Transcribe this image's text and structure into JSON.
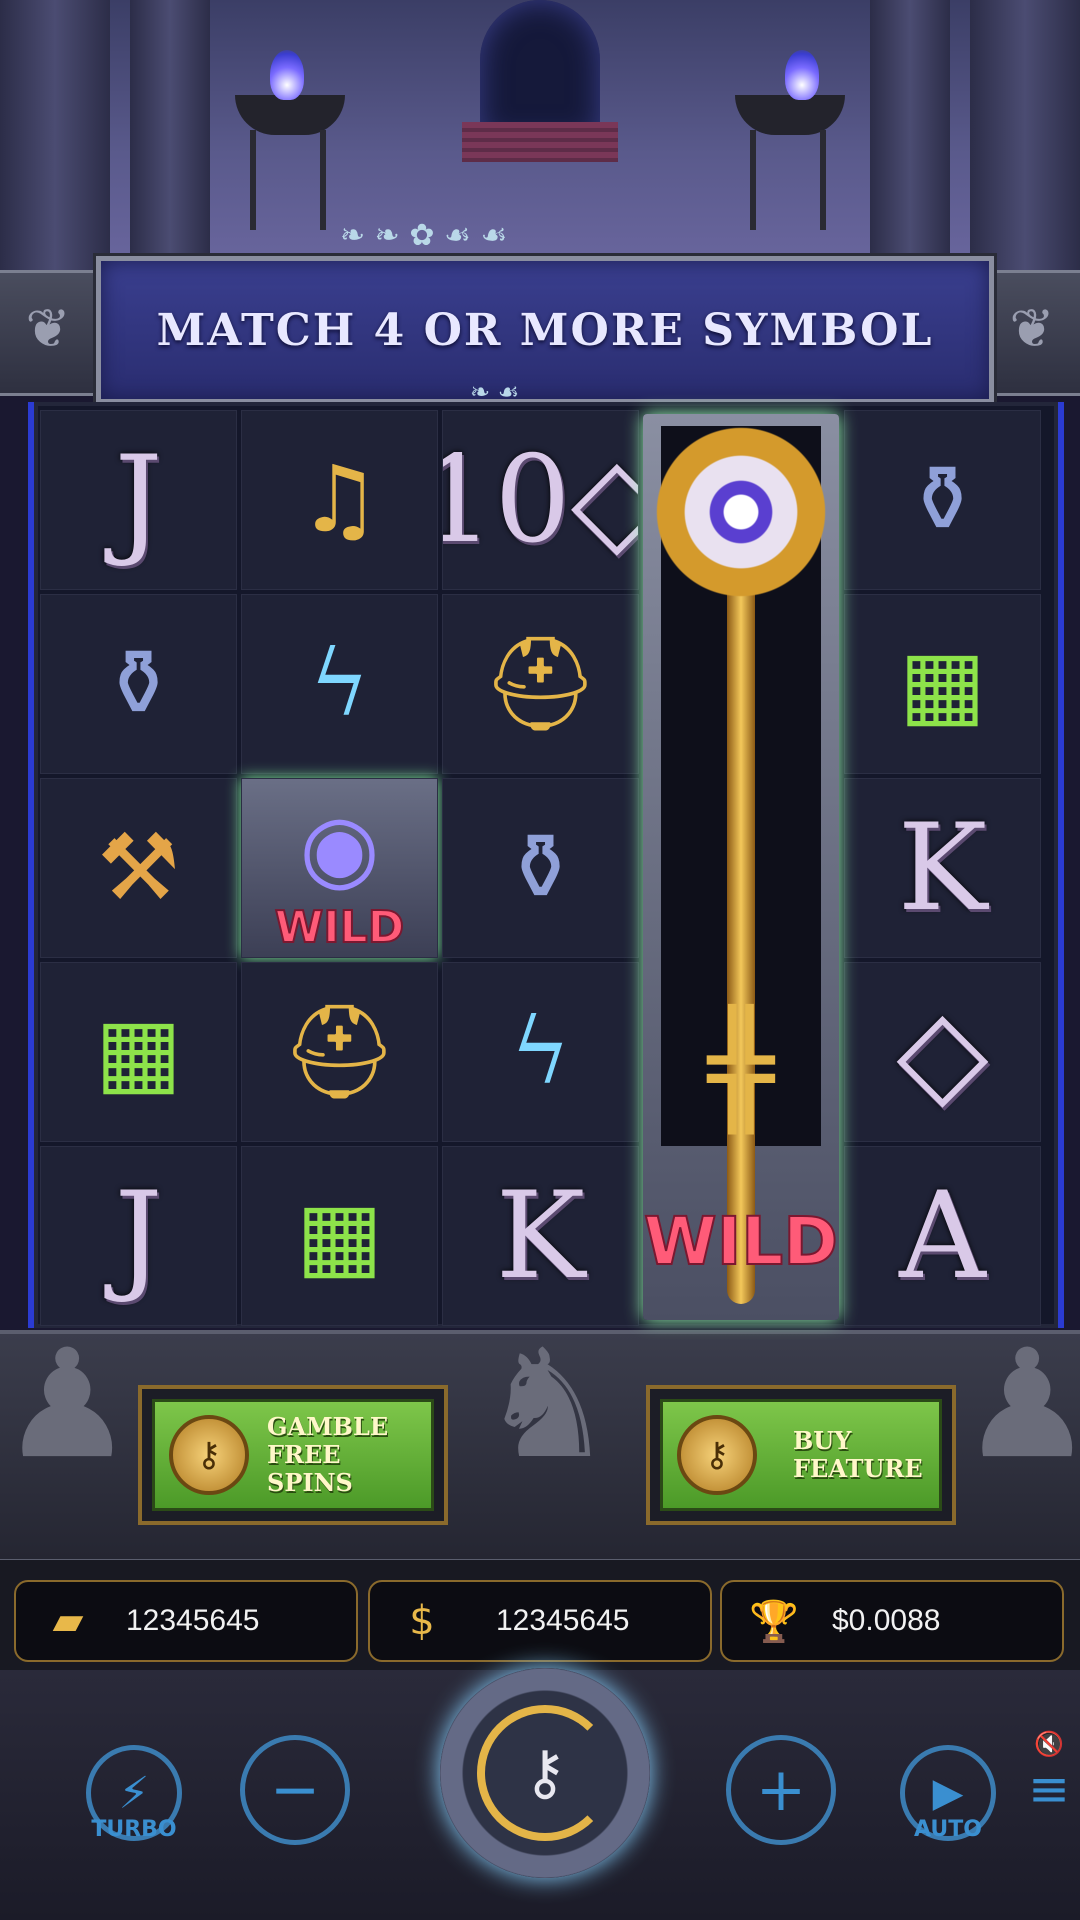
{
  "banner": {
    "text": "MATCH 4 OR MORE SYMBOL"
  },
  "grid": {
    "rows": [
      [
        "J",
        "lyre",
        "10◇",
        "key-wild",
        "vase"
      ],
      [
        "vase",
        "laurel-lightning",
        "helmet",
        "key-wild",
        "chest"
      ],
      [
        "hammer",
        "eye-wild",
        "vase",
        "key-wild",
        "K"
      ],
      [
        "chest",
        "helmet",
        "laurel-lightning",
        "key-wild",
        "◇"
      ],
      [
        "J",
        "chest",
        "K",
        "key-wild",
        "A"
      ]
    ],
    "wild_label": "WILD"
  },
  "buttons": {
    "gamble": {
      "line1": "GAMBLE",
      "line2": "FREE SPINS"
    },
    "buy": {
      "line1": "BUY",
      "line2": "FEATURE"
    }
  },
  "info": {
    "balance": "12345645",
    "bet": "12345645",
    "win": "$0.0088"
  },
  "controls": {
    "turbo_label": "TURBO",
    "auto_label": "AUTO"
  },
  "colors": {
    "accent_gold": "#e4b548",
    "control_blue": "#3a8fd0",
    "wild_pink": "#ff5b78"
  }
}
